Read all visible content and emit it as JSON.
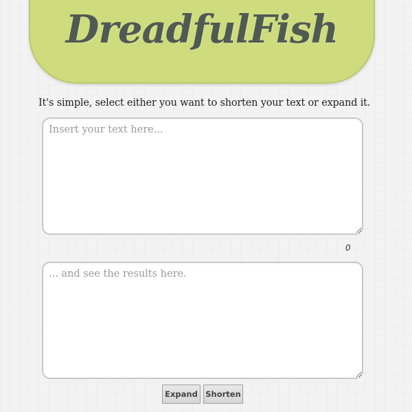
{
  "header": {
    "logo_text": "DreadfulFish",
    "background_color": "#cfdc7e",
    "logo_color": "#4f5a52"
  },
  "intro_text": "It's simple, select either you want to shorten your text or expand it.",
  "input": {
    "placeholder": "Insert your text here...",
    "value": ""
  },
  "counter": "0",
  "output": {
    "placeholder": "... and see the results here.",
    "value": ""
  },
  "buttons": {
    "expand_label": "Expand",
    "shorten_label": "Shorten"
  }
}
